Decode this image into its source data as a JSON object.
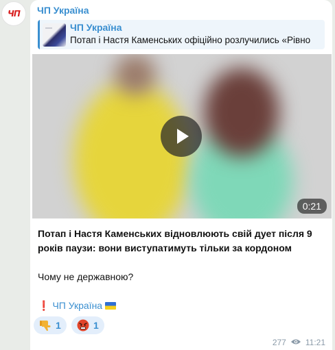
{
  "channel": {
    "name": "ЧП Україна",
    "avatar_text": "ЧП"
  },
  "forward": {
    "title": "ЧП Україна",
    "text": "Потап і Настя Каменських офіційно розлучились «Рівно"
  },
  "video": {
    "duration": "0:21"
  },
  "post": {
    "headline": "Потап і Настя Каменських відновлюють свій дует після 9 років паузи: вони виступатимуть тільки за кордоном",
    "question": "Чому не державною?",
    "signature_mark": "❗",
    "signature": "ЧП Україна"
  },
  "reactions": [
    {
      "icon": "thumbs-down-icon",
      "count": "1"
    },
    {
      "icon": "angry-face-icon",
      "count": "1"
    }
  ],
  "meta": {
    "views": "277",
    "time": "11:21"
  },
  "colors": {
    "accent": "#3a8fd0",
    "background": "#e9ece8",
    "bubble": "#ffffff",
    "reaction_bg": "#e3eefb"
  }
}
